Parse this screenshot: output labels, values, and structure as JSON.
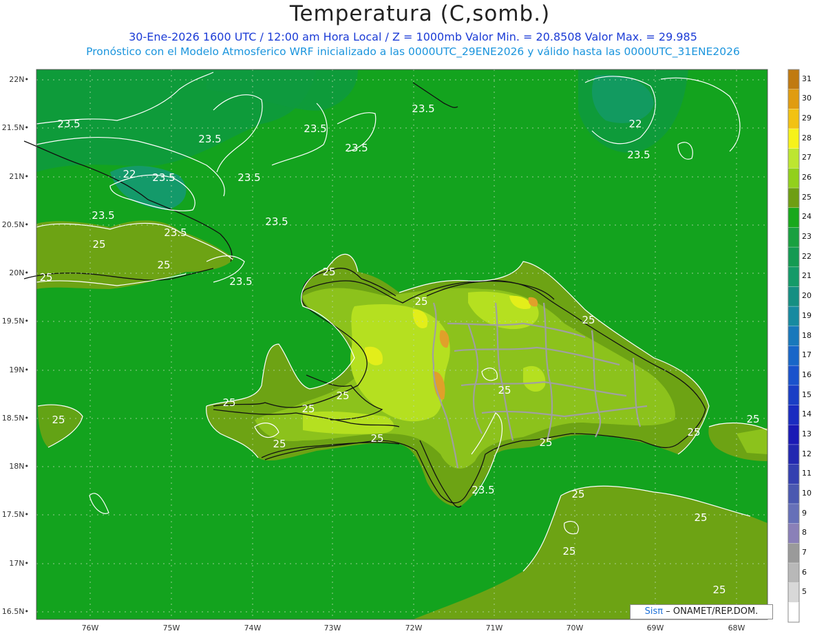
{
  "header": {
    "title": "Temperatura (C,somb.)",
    "line1": "30-Ene-2026 1600 UTC / 12:00 am Hora Local / Z = 1000mb   Valor Min. = 20.8508  Valor Max. = 29.985",
    "line2": "Pronóstico con el Modelo Atmosferico WRF inicializado a las 0000UTC_29ENE2026 y válido hasta las  0000UTC_31ENE2026"
  },
  "map": {
    "lat_labels": [
      "22N",
      "21.5N",
      "21N",
      "20.5N",
      "20N",
      "19.5N",
      "19N",
      "18.5N",
      "18N",
      "17.5N",
      "17N",
      "16.5N"
    ],
    "lon_labels": [
      "76W",
      "75W",
      "74W",
      "73W",
      "72W",
      "71W",
      "70W",
      "69W",
      "68W"
    ],
    "contour_labels": [
      "23.5",
      "22",
      "25"
    ],
    "colors": {
      "ocean": "#13a31e",
      "ocean_dark": "#0e9a40",
      "teal": "#149a6a",
      "land_low": "#6da314",
      "land_mid": "#8cc21c",
      "land_high": "#b5e020",
      "land_peak": "#e3ee1a",
      "hot": "#e0a02a"
    }
  },
  "colorbar": {
    "ticks": [
      "31",
      "30",
      "29",
      "28",
      "27",
      "26",
      "25",
      "24",
      "23",
      "22",
      "21",
      "20",
      "19",
      "18",
      "17",
      "16",
      "15",
      "14",
      "13",
      "12",
      "11",
      "10",
      "9",
      "8",
      "7",
      "6",
      "5"
    ],
    "colors": [
      "#c07a10",
      "#e09c10",
      "#f2c212",
      "#f6f21a",
      "#bde630",
      "#92d01c",
      "#6e9e13",
      "#18a81c",
      "#19a040",
      "#149a52",
      "#149a68",
      "#158f82",
      "#178aa0",
      "#1878bb",
      "#1866c8",
      "#1a52cc",
      "#1a3ec5",
      "#1a2cc0",
      "#1a1ab5",
      "#2228b0",
      "#3440b0",
      "#4a58b0",
      "#6670b8",
      "#8a80b8",
      "#9a9a9a",
      "#b8b8b8",
      "#d8d8d8",
      "#ffffff"
    ]
  },
  "credit": {
    "sis": "Sisπ",
    "rest": "– ONAMET/REP.DOM."
  }
}
